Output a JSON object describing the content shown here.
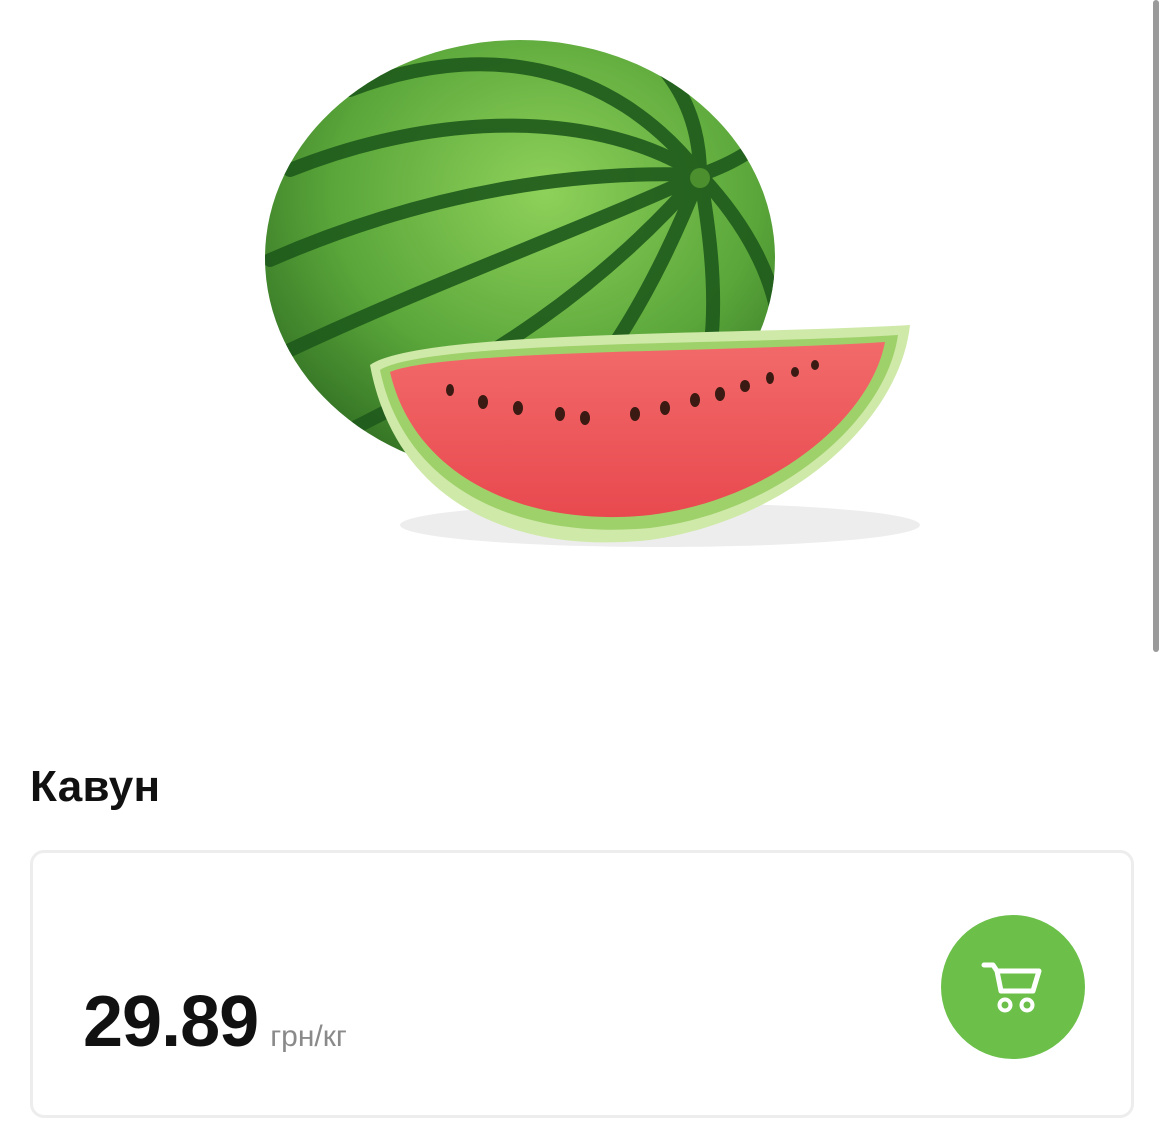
{
  "product": {
    "title": "Кавун",
    "price": "29.89",
    "unit": "грн/кг",
    "image_description_icon": "watermelon-image"
  },
  "actions": {
    "add_to_cart_icon": "cart-icon"
  },
  "colors": {
    "accent": "#6cc04a",
    "text_primary": "#111111",
    "text_secondary": "#8a8a8a",
    "card_border": "#ededed"
  }
}
